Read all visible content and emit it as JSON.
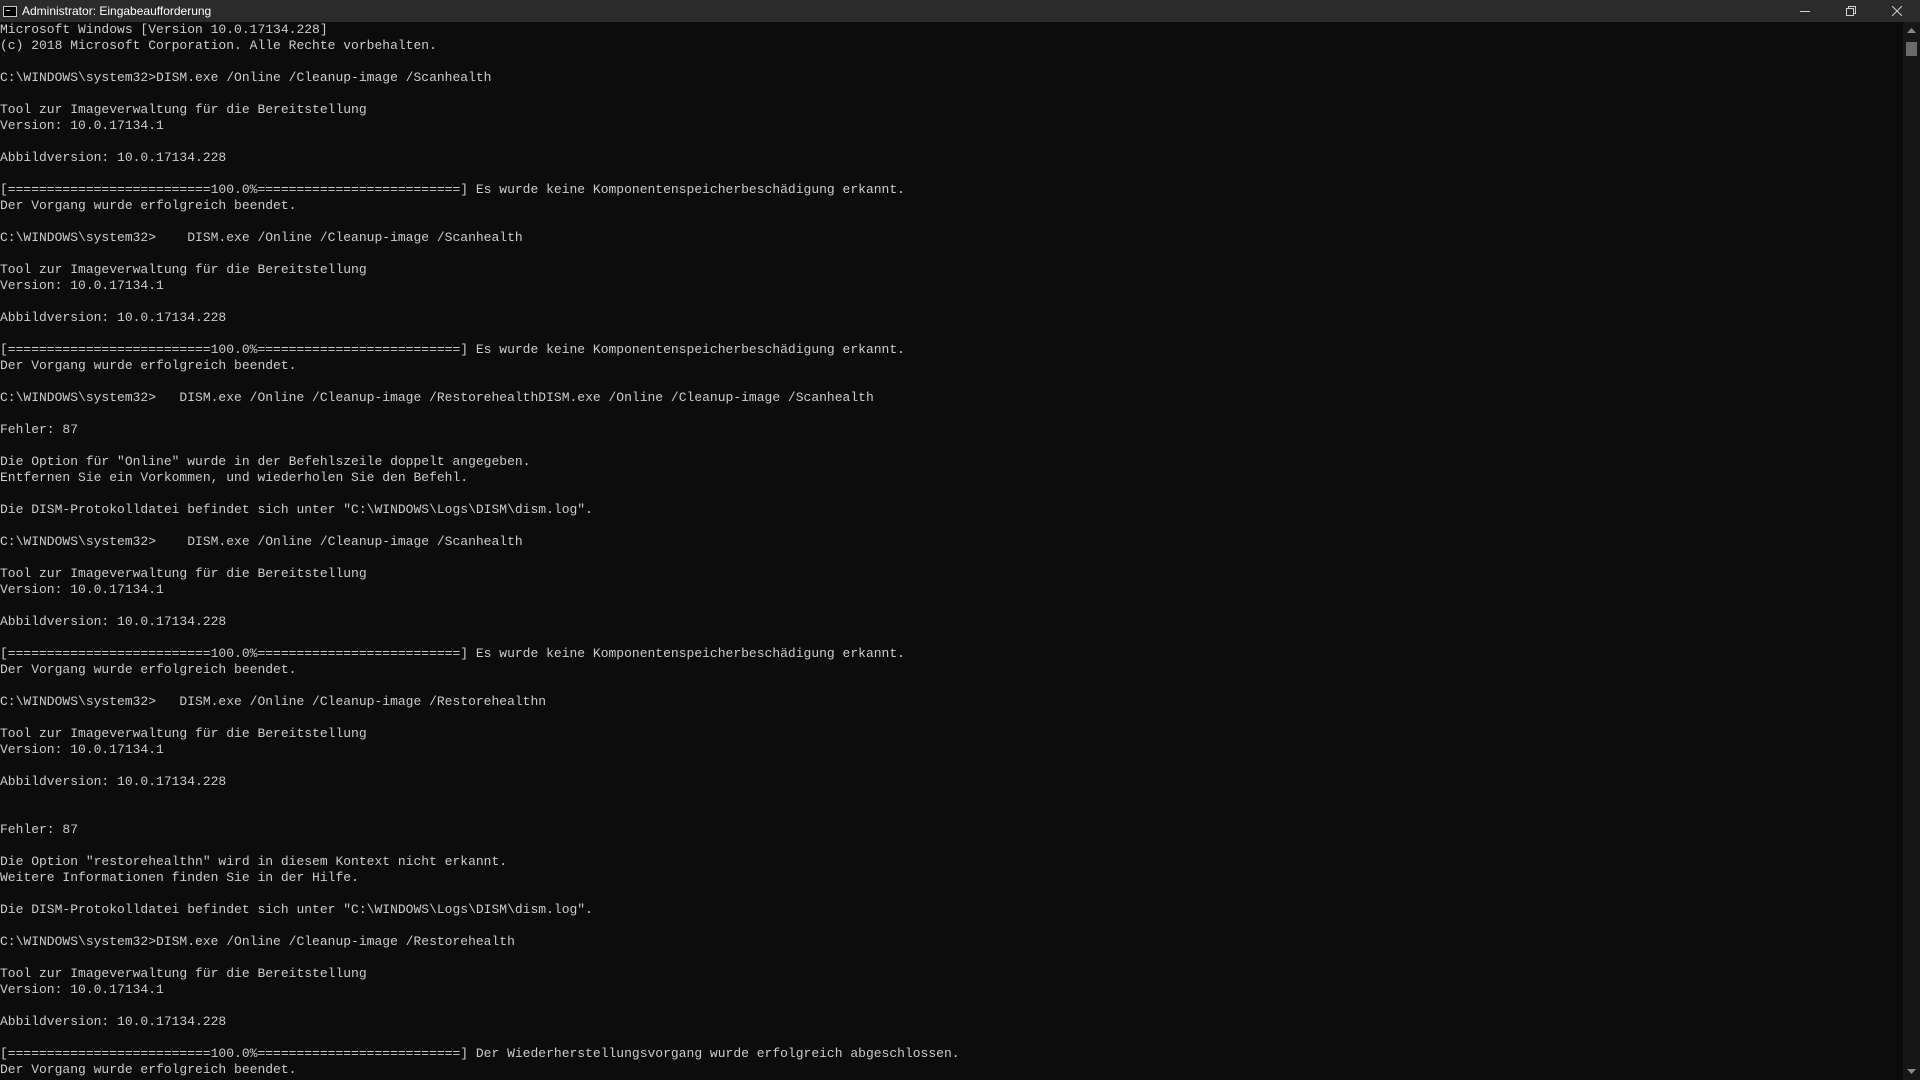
{
  "window": {
    "title": "Administrator: Eingabeaufforderung",
    "icon": "cmd-icon",
    "controls": [
      "minimize-icon",
      "restore-icon",
      "close-icon"
    ]
  },
  "console": {
    "lines": [
      "Microsoft Windows [Version 10.0.17134.228]",
      "(c) 2018 Microsoft Corporation. Alle Rechte vorbehalten.",
      "",
      "C:\\WINDOWS\\system32>DISM.exe /Online /Cleanup-image /Scanhealth",
      "",
      "Tool zur Imageverwaltung für die Bereitstellung",
      "Version: 10.0.17134.1",
      "",
      "Abbildversion: 10.0.17134.228",
      "",
      "[==========================100.0%==========================] Es wurde keine Komponentenspeicherbeschädigung erkannt.",
      "Der Vorgang wurde erfolgreich beendet.",
      "",
      "C:\\WINDOWS\\system32>    DISM.exe /Online /Cleanup-image /Scanhealth",
      "",
      "Tool zur Imageverwaltung für die Bereitstellung",
      "Version: 10.0.17134.1",
      "",
      "Abbildversion: 10.0.17134.228",
      "",
      "[==========================100.0%==========================] Es wurde keine Komponentenspeicherbeschädigung erkannt.",
      "Der Vorgang wurde erfolgreich beendet.",
      "",
      "C:\\WINDOWS\\system32>   DISM.exe /Online /Cleanup-image /RestorehealthDISM.exe /Online /Cleanup-image /Scanhealth",
      "",
      "Fehler: 87",
      "",
      "Die Option für \"Online\" wurde in der Befehlszeile doppelt angegeben.",
      "Entfernen Sie ein Vorkommen, und wiederholen Sie den Befehl.",
      "",
      "Die DISM-Protokolldatei befindet sich unter \"C:\\WINDOWS\\Logs\\DISM\\dism.log\".",
      "",
      "C:\\WINDOWS\\system32>    DISM.exe /Online /Cleanup-image /Scanhealth",
      "",
      "Tool zur Imageverwaltung für die Bereitstellung",
      "Version: 10.0.17134.1",
      "",
      "Abbildversion: 10.0.17134.228",
      "",
      "[==========================100.0%==========================] Es wurde keine Komponentenspeicherbeschädigung erkannt.",
      "Der Vorgang wurde erfolgreich beendet.",
      "",
      "C:\\WINDOWS\\system32>   DISM.exe /Online /Cleanup-image /Restorehealthn",
      "",
      "Tool zur Imageverwaltung für die Bereitstellung",
      "Version: 10.0.17134.1",
      "",
      "Abbildversion: 10.0.17134.228",
      "",
      "",
      "Fehler: 87",
      "",
      "Die Option \"restorehealthn\" wird in diesem Kontext nicht erkannt.",
      "Weitere Informationen finden Sie in der Hilfe.",
      "",
      "Die DISM-Protokolldatei befindet sich unter \"C:\\WINDOWS\\Logs\\DISM\\dism.log\".",
      "",
      "C:\\WINDOWS\\system32>DISM.exe /Online /Cleanup-image /Restorehealth",
      "",
      "Tool zur Imageverwaltung für die Bereitstellung",
      "Version: 10.0.17134.1",
      "",
      "Abbildversion: 10.0.17134.228",
      "",
      "[==========================100.0%==========================] Der Wiederherstellungsvorgang wurde erfolgreich abgeschlossen.",
      "Der Vorgang wurde erfolgreich beendet."
    ]
  },
  "scrollbar": {
    "up_icon": "scroll-up-arrow-icon",
    "down_icon": "scroll-down-arrow-icon"
  }
}
